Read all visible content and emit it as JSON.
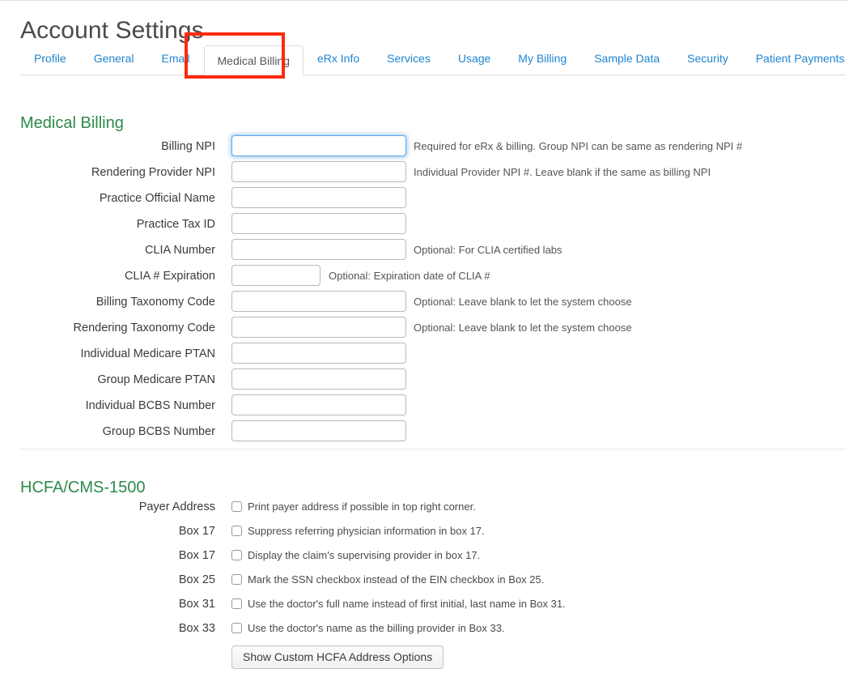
{
  "page": {
    "title": "Account Settings"
  },
  "tabs": [
    {
      "label": "Profile",
      "active": false
    },
    {
      "label": "General",
      "active": false
    },
    {
      "label": "Email",
      "active": false
    },
    {
      "label": "Medical Billing",
      "active": true
    },
    {
      "label": "eRx Info",
      "active": false
    },
    {
      "label": "Services",
      "active": false
    },
    {
      "label": "Usage",
      "active": false
    },
    {
      "label": "My Billing",
      "active": false
    },
    {
      "label": "Sample Data",
      "active": false
    },
    {
      "label": "Security",
      "active": false
    },
    {
      "label": "Patient Payments",
      "active": false
    }
  ],
  "highlight": {
    "target_tab": "Medical Billing",
    "color": "#fc2a10"
  },
  "sections": {
    "medical_billing": {
      "heading": "Medical Billing",
      "heading_color": "#2d8a4a",
      "fields": [
        {
          "label": "Billing NPI",
          "value": "",
          "placeholder": "",
          "hint": "Required for eRx & billing. Group NPI can be same as rendering NPI #",
          "focused": true,
          "short": false
        },
        {
          "label": "Rendering Provider NPI",
          "value": "",
          "placeholder": "",
          "hint": "Individual Provider NPI #. Leave blank if the same as billing NPI",
          "focused": false,
          "short": false
        },
        {
          "label": "Practice Official Name",
          "value": "",
          "placeholder": "",
          "hint": "",
          "focused": false,
          "short": false
        },
        {
          "label": "Practice Tax ID",
          "value": "",
          "placeholder": "",
          "hint": "",
          "focused": false,
          "short": false
        },
        {
          "label": "CLIA Number",
          "value": "",
          "placeholder": "",
          "hint": "Optional: For CLIA certified labs",
          "focused": false,
          "short": false
        },
        {
          "label": "CLIA # Expiration",
          "value": "",
          "placeholder": "",
          "hint": "Optional: Expiration date of CLIA #",
          "focused": false,
          "short": true
        },
        {
          "label": "Billing Taxonomy Code",
          "value": "",
          "placeholder": "",
          "hint": "Optional: Leave blank to let the system choose",
          "focused": false,
          "short": false
        },
        {
          "label": "Rendering Taxonomy Code",
          "value": "",
          "placeholder": "",
          "hint": "Optional: Leave blank to let the system choose",
          "focused": false,
          "short": false
        },
        {
          "label": "Individual Medicare PTAN",
          "value": "",
          "placeholder": "",
          "hint": "",
          "focused": false,
          "short": false
        },
        {
          "label": "Group Medicare PTAN",
          "value": "",
          "placeholder": "",
          "hint": "",
          "focused": false,
          "short": false
        },
        {
          "label": "Individual BCBS Number",
          "value": "",
          "placeholder": "",
          "hint": "",
          "focused": false,
          "short": false
        },
        {
          "label": "Group BCBS Number",
          "value": "",
          "placeholder": "",
          "hint": "",
          "focused": false,
          "short": false
        }
      ]
    },
    "hcfa": {
      "heading": "HCFA/CMS-1500",
      "heading_color": "#2d8a4a",
      "checkboxes": [
        {
          "label": "Payer Address",
          "text": "Print payer address if possible in top right corner.",
          "checked": false
        },
        {
          "label": "Box 17",
          "text": "Suppress referring physician information in box 17.",
          "checked": false
        },
        {
          "label": "Box 17",
          "text": "Display the claim's supervising provider in box 17.",
          "checked": false
        },
        {
          "label": "Box 25",
          "text": "Mark the SSN checkbox instead of the EIN checkbox in Box 25.",
          "checked": false
        },
        {
          "label": "Box 31",
          "text": "Use the doctor's full name instead of first initial, last name in Box 31.",
          "checked": false
        },
        {
          "label": "Box 33",
          "text": "Use the doctor's name as the billing provider in Box 33.",
          "checked": false
        }
      ],
      "button": {
        "label": "Show Custom HCFA Address Options"
      }
    }
  }
}
